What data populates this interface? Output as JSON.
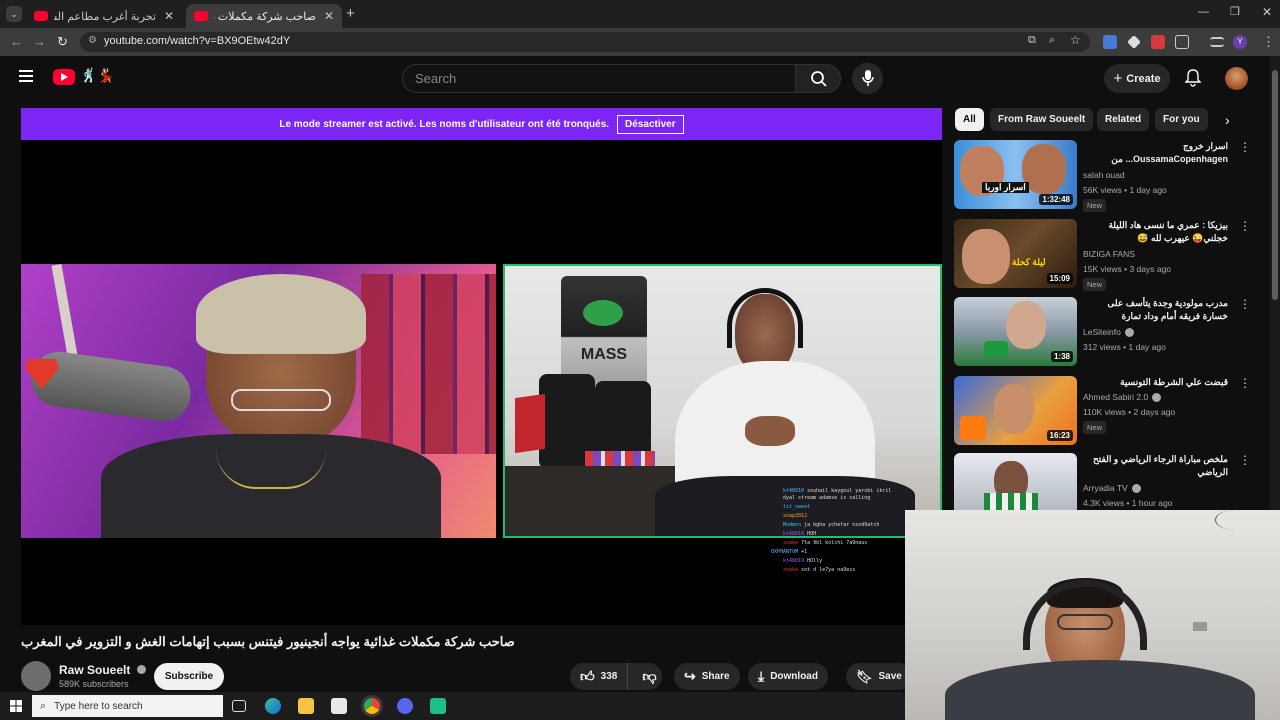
{
  "browser": {
    "tabs": [
      {
        "title": "تجربة أغرب مطاعم الشاورما في ال",
        "active": false
      },
      {
        "title": "صاحب شركة مكملات غدائية ي",
        "active": true
      }
    ],
    "url": "youtube.com/watch?v=BX9OEtw42dY",
    "profile_initial": "Y"
  },
  "youtube": {
    "search_placeholder": "Search",
    "create_label": "Create",
    "logo_text": "🕺🏻💃🏻"
  },
  "player": {
    "streamer_notice": "Le mode streamer est activé. Les noms d'utilisateur ont été tronqués.",
    "streamer_button": "Désactiver",
    "bag_label": "MASS",
    "chat": [
      {
        "user": "kt48010",
        "msg": "souhail kaygoul yarobi ikril"
      },
      {
        "user": "",
        "msg": "dyal stream adamse is calling"
      },
      {
        "user": "lit_sweet",
        "msg": ""
      },
      {
        "user": "snap2012",
        "msg": ""
      },
      {
        "user": "Modmsn",
        "msg": "ja bgha ychefar nsod9atch"
      },
      {
        "user": "kt48010",
        "msg": "HOH"
      },
      {
        "user": "snake",
        "msg": "7ta 9bl kolchi 7a9naus"
      },
      {
        "user": "0XPHANTOM",
        "msg": "+1"
      },
      {
        "user": "kt48019",
        "msg": "HOlly"
      },
      {
        "user": "snake",
        "msg": "sot d le7ya na9ess"
      }
    ]
  },
  "video": {
    "title": "صاحب شركة مكملات غذائية يواجه أنجينيور فيتنس بسبب إتهامات الغش و التزوير في المغرب",
    "channel": "Raw Soueelt",
    "subscribers": "589K subscribers",
    "subscribe_label": "Subscribe",
    "likes": "338",
    "share_label": "Share",
    "download_label": "Download",
    "save_label": "Save"
  },
  "sidebar": {
    "chips": [
      "All",
      "From Raw Soueelt",
      "Related",
      "For you"
    ],
    "recs": [
      {
        "title": "اسرار خروج OussamaCopenhagen... من الغش...",
        "channel": "salah ouad",
        "verified": false,
        "meta": "56K views • 1 day ago",
        "badge": "New",
        "duration": "1:32:48",
        "thumb_text": "اسرار اوربا"
      },
      {
        "title": "بيزيكا : عمري ما ننسى هاد الليلة خجلني😜 عيهرب لله 😅",
        "channel": "BIZIGA FANS",
        "verified": false,
        "meta": "15K views • 3 days ago",
        "badge": "New",
        "duration": "15:09",
        "thumb_text": "ليلة كحلة"
      },
      {
        "title": "مدرب مولودية وجدة يتأسف على خسارة فريقه أمام وداد تمارة",
        "channel": "LeSiteinfo",
        "verified": true,
        "meta": "312 views • 1 day ago",
        "badge": "",
        "duration": "1:38",
        "thumb_text": ""
      },
      {
        "title": "قبضت علي الشرطة التونسية",
        "channel": "Ahmed Sabiri 2.0",
        "verified": true,
        "meta": "110K views • 2 days ago",
        "badge": "New",
        "duration": "16:23",
        "thumb_text": ""
      },
      {
        "title": "ملخص مباراة الرجاء الرياضي و الفتح الرياضي",
        "channel": "Arryadia TV",
        "verified": true,
        "meta": "4.3K views • 1 hour ago",
        "badge": "",
        "duration": "",
        "thumb_text": ""
      }
    ]
  },
  "taskbar": {
    "search_placeholder": "Type here to search"
  }
}
